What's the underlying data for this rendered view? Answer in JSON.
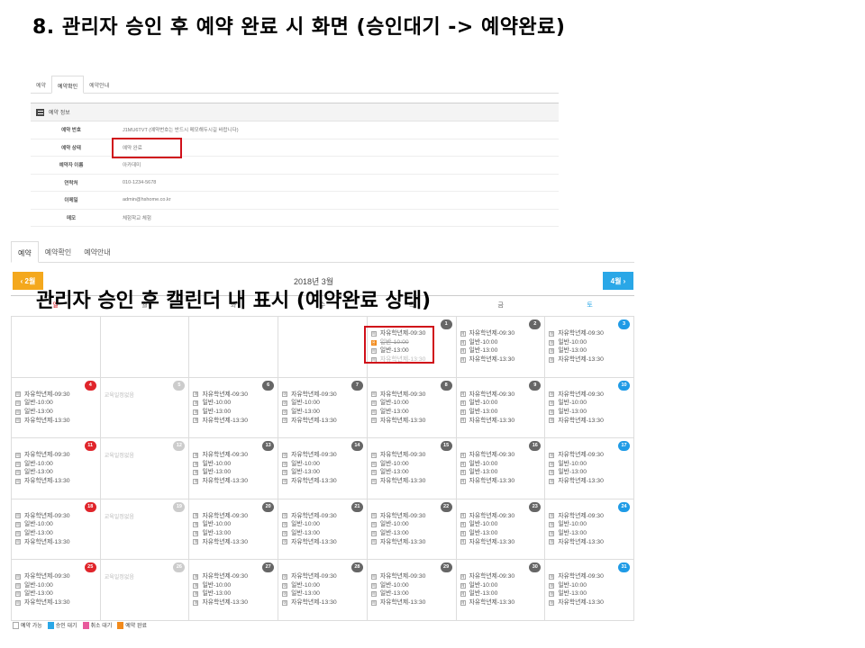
{
  "slide_title": "8. 관리자 승인 후 예약 완료 시 화면 (승인대기 -> 예약완료)",
  "overlay_title": "관리자 승인 후  캘린더 내 표시 (예약완료 상태)",
  "info_panel": {
    "tabs": [
      "예약",
      "예약확인",
      "예약안내"
    ],
    "header": "예약 정보",
    "rows": [
      {
        "key": "예약 번호",
        "value": "J1MU6TVT (예약번호는 반드시 메모해두시길 바랍니다)"
      },
      {
        "key": "예약 상태",
        "value": "예약 완료"
      },
      {
        "key": "예약자 이름",
        "value": "아카데미"
      },
      {
        "key": "연락처",
        "value": "010-1234-5678"
      },
      {
        "key": "이메일",
        "value": "admin@hshome.co.kr"
      },
      {
        "key": "메모",
        "value": "체험학교 체험"
      }
    ]
  },
  "calendar": {
    "tabs": [
      "예약",
      "예약확인",
      "예약안내"
    ],
    "prev_label": "2월",
    "next_label": "4월",
    "month_title": "2018년 3월",
    "weekdays": [
      "일",
      "월",
      "화",
      "수",
      "목",
      "금",
      "토"
    ],
    "closed_text": "교육일정없음",
    "slot_labels": [
      "자유학년제-09:30",
      "일반-10:00",
      "일반-13:00",
      "자유학년제-13:30"
    ],
    "weeks": [
      [
        null,
        null,
        null,
        null,
        {
          "day": "1",
          "type": "wk",
          "done": 1
        },
        {
          "day": "2",
          "type": "wk"
        },
        {
          "day": "3",
          "type": "sat"
        }
      ],
      [
        {
          "day": "4",
          "type": "sun"
        },
        {
          "day": "5",
          "type": "hol"
        },
        {
          "day": "6",
          "type": "wk"
        },
        {
          "day": "7",
          "type": "wk"
        },
        {
          "day": "8",
          "type": "wk"
        },
        {
          "day": "9",
          "type": "wk"
        },
        {
          "day": "10",
          "type": "sat"
        }
      ],
      [
        {
          "day": "11",
          "type": "sun"
        },
        {
          "day": "12",
          "type": "hol"
        },
        {
          "day": "13",
          "type": "wk"
        },
        {
          "day": "14",
          "type": "wk"
        },
        {
          "day": "15",
          "type": "wk"
        },
        {
          "day": "16",
          "type": "wk"
        },
        {
          "day": "17",
          "type": "sat"
        }
      ],
      [
        {
          "day": "18",
          "type": "sun"
        },
        {
          "day": "19",
          "type": "hol"
        },
        {
          "day": "20",
          "type": "wk"
        },
        {
          "day": "21",
          "type": "wk"
        },
        {
          "day": "22",
          "type": "wk"
        },
        {
          "day": "23",
          "type": "wk"
        },
        {
          "day": "24",
          "type": "sat"
        }
      ],
      [
        {
          "day": "25",
          "type": "sun"
        },
        {
          "day": "26",
          "type": "hol"
        },
        {
          "day": "27",
          "type": "wk"
        },
        {
          "day": "28",
          "type": "wk"
        },
        {
          "day": "29",
          "type": "wk"
        },
        {
          "day": "30",
          "type": "wk"
        },
        {
          "day": "31",
          "type": "sat"
        }
      ]
    ],
    "legend": [
      {
        "label": "예약 가능",
        "color": "white"
      },
      {
        "label": "승인 대기",
        "color": "blue"
      },
      {
        "label": "취소 대기",
        "color": "pink"
      },
      {
        "label": "예약 완료",
        "color": "orange"
      }
    ]
  }
}
